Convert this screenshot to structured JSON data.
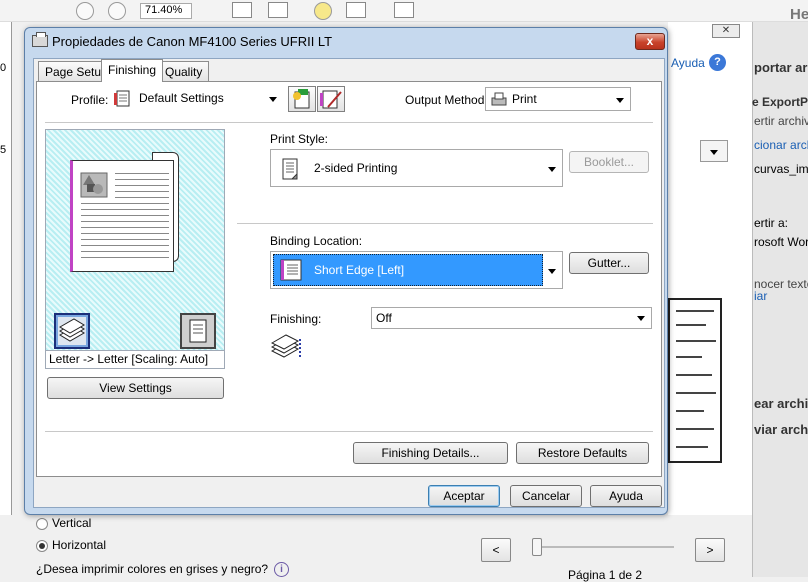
{
  "background": {
    "zoom_value": "71.40%",
    "header_partial": "He",
    "right_panel": {
      "help_link": "Ayuda",
      "export_heading": "portar archivo",
      "export_sub": "e ExportPDF",
      "convert_text": "ertir archivos",
      "select_link": "cionar archivo",
      "file_name": "curvas_impri",
      "convert_to": "ertir a:",
      "word_option": "rosoft Word",
      "recognize": "nocer texto en",
      "change_link": "iar",
      "create_heading": "ear archivo",
      "send_heading": "viar archivos"
    },
    "left_doc_fragments": [
      "0",
      "5"
    ],
    "orientation": {
      "vertical_label": "Vertical",
      "horizontal_label": "Horizontal",
      "selected": "Horizontal"
    },
    "gray_question": "¿Desea imprimir colores en grises y negro?",
    "prev_button": "<",
    "next_button": ">",
    "page_indicator": "Página 1 de 2"
  },
  "dialog": {
    "title": "Propiedades de Canon MF4100 Series UFRII LT",
    "close_label": "x",
    "tabs": [
      {
        "label": "Page Setup",
        "active": false
      },
      {
        "label": "Finishing",
        "active": true
      },
      {
        "label": "Quality",
        "active": false
      }
    ],
    "profile": {
      "label": "Profile:",
      "value": "Default Settings"
    },
    "output_method": {
      "label": "Output Method:",
      "value": "Print"
    },
    "preview_caption": "Letter -> Letter [Scaling: Auto]",
    "view_settings_button": "View Settings",
    "print_style": {
      "label": "Print Style:",
      "value": "2-sided Printing"
    },
    "booklet_button": "Booklet...",
    "binding_location": {
      "label": "Binding Location:",
      "value": "Short Edge [Left]"
    },
    "gutter_button": "Gutter...",
    "finishing": {
      "label": "Finishing:",
      "value": "Off"
    },
    "finishing_details_button": "Finishing Details...",
    "restore_defaults_button": "Restore Defaults",
    "ok_button": "Aceptar",
    "cancel_button": "Cancelar",
    "help_button": "Ayuda"
  },
  "colors": {
    "selected_highlight": "#3399ff",
    "preview_hatch": "#b8eef2",
    "binding_edge": "#c043c4",
    "close_red": "#c9432b"
  }
}
